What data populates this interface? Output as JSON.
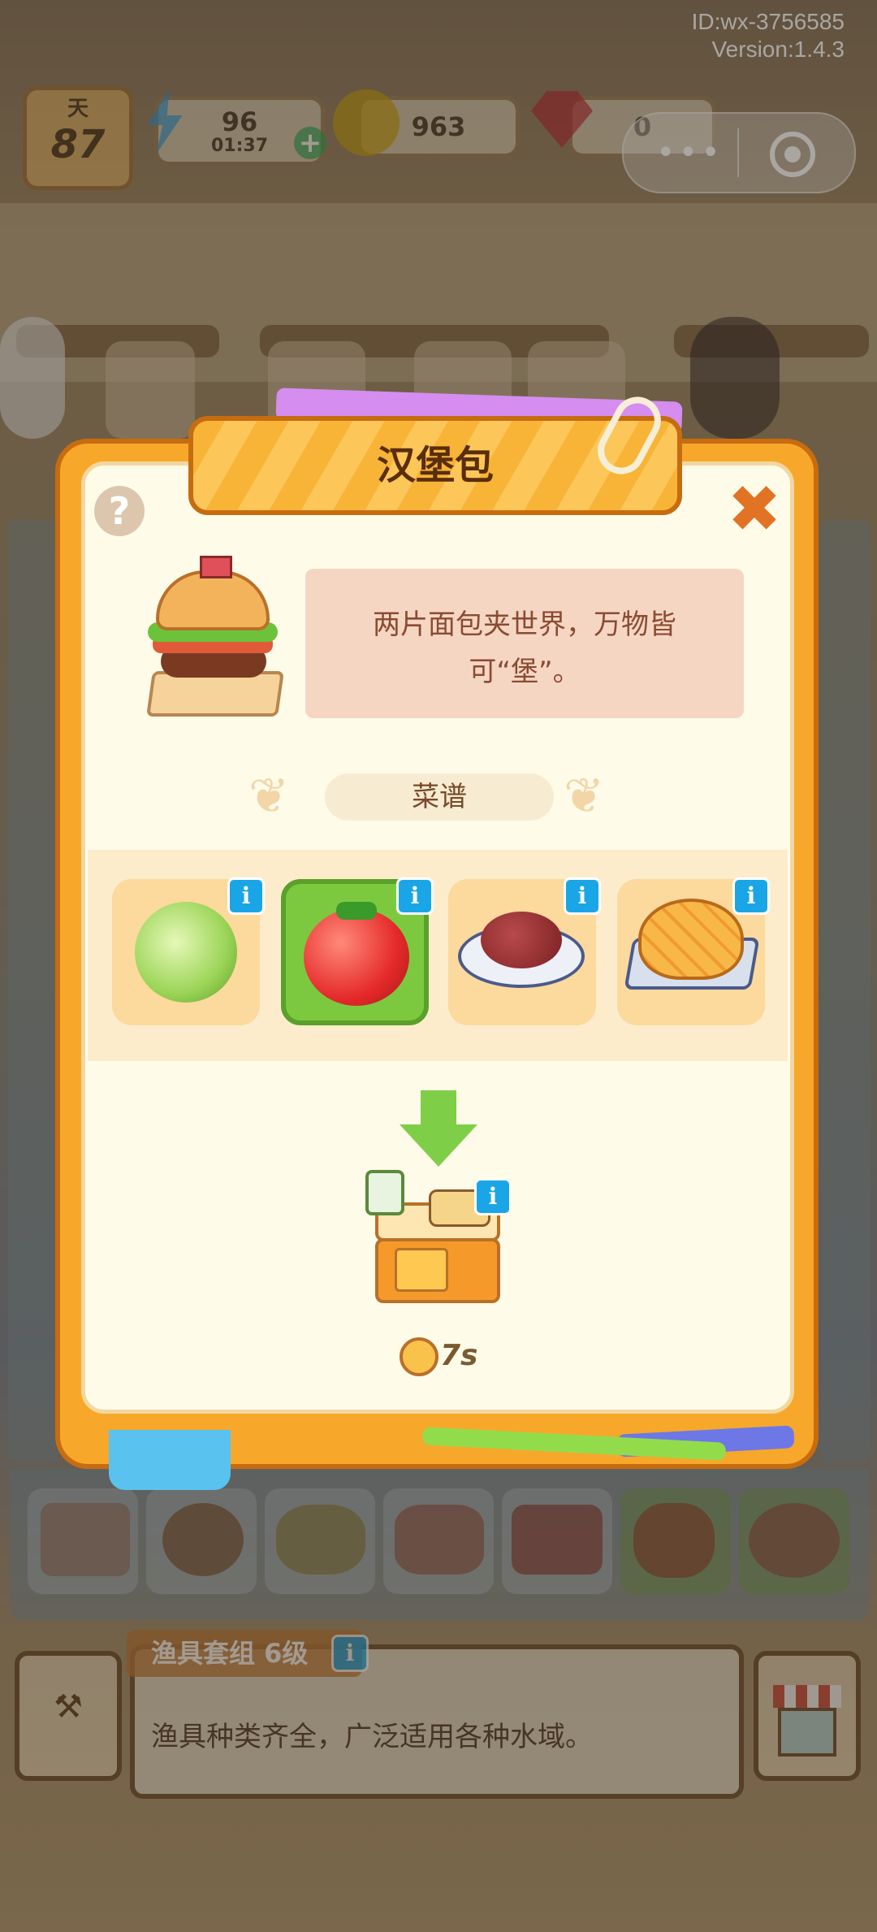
{
  "system": {
    "id_text": "ID:wx-3756585",
    "version_text": "Version:1.4.3"
  },
  "hud": {
    "day_label": "天",
    "day_value": "87",
    "energy_value": "96",
    "energy_timer": "01:37",
    "coins_value": "963",
    "gems_value": "0"
  },
  "dialog": {
    "title": "汉堡包",
    "help_icon": "?",
    "close_icon": "✖",
    "description": "两片面包夹世界，万物皆可“堡”。",
    "recipe_label": "菜谱",
    "ingredients": [
      {
        "name": "lettuce",
        "icon": "lettuce-icon",
        "selected": false
      },
      {
        "name": "tomato",
        "icon": "tomato-icon",
        "selected": true
      },
      {
        "name": "beef-patty",
        "icon": "patty-icon",
        "selected": false
      },
      {
        "name": "bun",
        "icon": "bun-icon",
        "selected": false
      }
    ],
    "info_glyph": "i",
    "cook_time": "7s"
  },
  "bottom": {
    "item_title": "渔具套组 6级",
    "item_description": "渔具种类齐全，广泛适用各种水域。",
    "info_glyph": "i"
  },
  "colors": {
    "panel_orange": "#f7a82a",
    "selected_green": "#7cc940",
    "info_blue": "#1aa6e6"
  }
}
